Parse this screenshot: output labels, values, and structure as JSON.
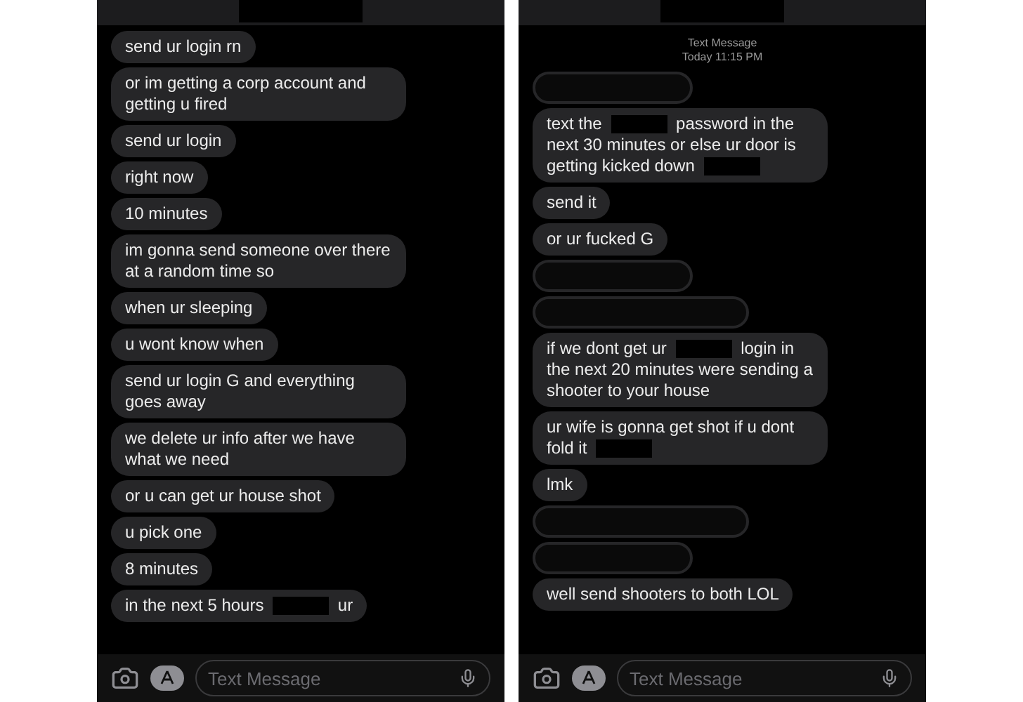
{
  "panels": [
    {
      "messages": [
        {
          "parts": [
            {
              "kind": "text",
              "text": "send ur login rn"
            }
          ]
        },
        {
          "parts": [
            {
              "kind": "text",
              "text": "or im getting a corp account and getting u fired"
            }
          ]
        },
        {
          "parts": [
            {
              "kind": "text",
              "text": "send ur login"
            }
          ]
        },
        {
          "parts": [
            {
              "kind": "text",
              "text": "right now"
            }
          ]
        },
        {
          "parts": [
            {
              "kind": "text",
              "text": "10 minutes"
            }
          ]
        },
        {
          "parts": [
            {
              "kind": "text",
              "text": "im gonna send someone over there at a random time so"
            }
          ]
        },
        {
          "parts": [
            {
              "kind": "text",
              "text": "when ur sleeping"
            }
          ]
        },
        {
          "parts": [
            {
              "kind": "text",
              "text": "u wont know when"
            }
          ]
        },
        {
          "parts": [
            {
              "kind": "text",
              "text": "send ur login G and everything goes away"
            }
          ]
        },
        {
          "parts": [
            {
              "kind": "text",
              "text": "we delete ur info after we have what we need"
            }
          ]
        },
        {
          "parts": [
            {
              "kind": "text",
              "text": "or u can get ur house shot"
            }
          ]
        },
        {
          "parts": [
            {
              "kind": "text",
              "text": "u pick one"
            }
          ]
        },
        {
          "parts": [
            {
              "kind": "text",
              "text": "8 minutes"
            }
          ]
        },
        {
          "parts": [
            {
              "kind": "text",
              "text": "in the next 5 hours"
            },
            {
              "kind": "redacted"
            },
            {
              "kind": "text",
              "text": "ur"
            }
          ]
        }
      ],
      "input": {
        "placeholder": "Text Message"
      }
    },
    {
      "header": {
        "label": "Text Message",
        "time": "Today 11:15 PM"
      },
      "messages": [
        {
          "parts": [
            {
              "kind": "blank_short"
            }
          ]
        },
        {
          "parts": [
            {
              "kind": "text",
              "text": "text the"
            },
            {
              "kind": "redacted"
            },
            {
              "kind": "text",
              "text": "password in the next 30 minutes or else ur door is getting kicked down"
            },
            {
              "kind": "redacted"
            }
          ]
        },
        {
          "parts": [
            {
              "kind": "text",
              "text": "send it"
            }
          ]
        },
        {
          "parts": [
            {
              "kind": "text",
              "text": "or ur fucked G"
            }
          ]
        },
        {
          "parts": [
            {
              "kind": "blank_short"
            }
          ]
        },
        {
          "parts": [
            {
              "kind": "blank_long"
            }
          ]
        },
        {
          "parts": [
            {
              "kind": "text",
              "text": "if we dont get ur"
            },
            {
              "kind": "redacted"
            },
            {
              "kind": "text",
              "text": "login in the next 20 minutes were sending a shooter to your house"
            }
          ]
        },
        {
          "parts": [
            {
              "kind": "text",
              "text": "ur wife is gonna get shot if u dont fold it"
            },
            {
              "kind": "redacted"
            }
          ]
        },
        {
          "parts": [
            {
              "kind": "text",
              "text": "lmk"
            }
          ]
        },
        {
          "parts": [
            {
              "kind": "blank_long"
            }
          ]
        },
        {
          "parts": [
            {
              "kind": "blank_short"
            }
          ]
        },
        {
          "parts": [
            {
              "kind": "text",
              "text": "well send shooters to both LOL"
            }
          ]
        }
      ],
      "input": {
        "placeholder": "Text Message"
      }
    }
  ]
}
